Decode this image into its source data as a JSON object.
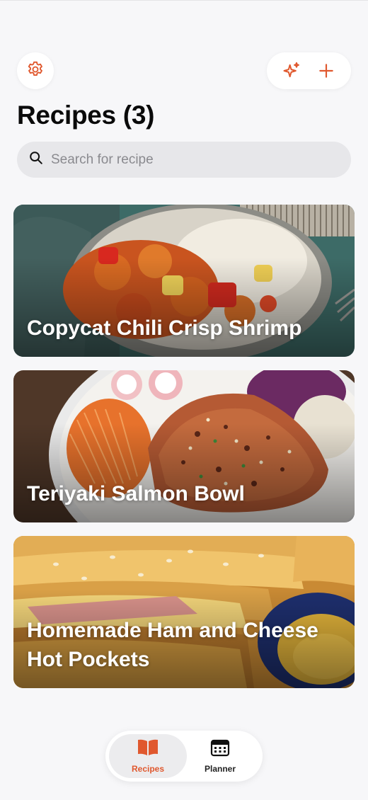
{
  "header": {
    "title": "Recipes (3)",
    "settings_icon": "gear-icon",
    "ai_icon": "sparkles-icon",
    "add_icon": "plus-icon"
  },
  "search": {
    "placeholder": "Search for recipe",
    "icon": "search-icon"
  },
  "recipes": [
    {
      "title": "Copycat Chili Crisp Shrimp"
    },
    {
      "title": "Teriyaki Salmon Bowl"
    },
    {
      "title": "Homemade Ham and Cheese Hot Pockets"
    }
  ],
  "tabbar": {
    "tabs": [
      {
        "label": "Recipes",
        "icon": "book-icon",
        "active": true
      },
      {
        "label": "Planner",
        "icon": "calendar-icon",
        "active": false
      }
    ]
  },
  "colors": {
    "accent": "#e0582e",
    "background": "#f7f7f9",
    "search_bg": "#e7e7ea"
  }
}
